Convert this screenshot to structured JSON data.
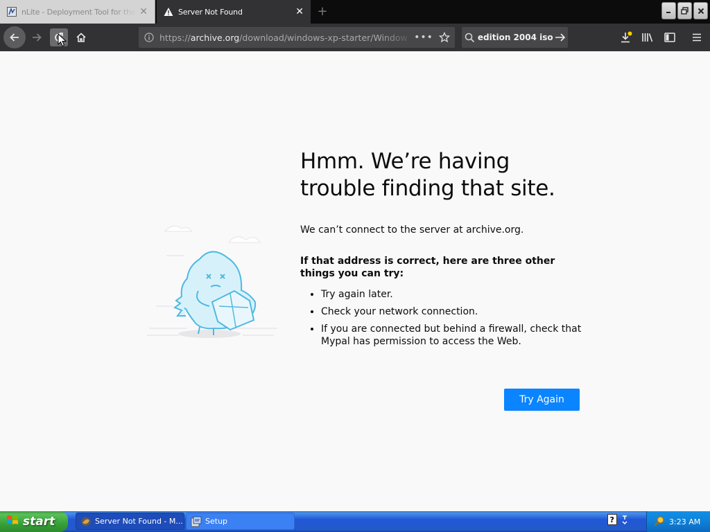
{
  "tabs": [
    {
      "title": "nLite - Deployment Tool for the b",
      "active": false,
      "favicon": "nlite-icon"
    },
    {
      "title": "Server Not Found",
      "active": true,
      "favicon": "warning-icon"
    }
  ],
  "toolbar": {
    "url_scheme": "https://",
    "url_domain": "archive.org",
    "url_path": "/download/windows-xp-starter/Window",
    "search_text": "edition 2004 iso"
  },
  "error_page": {
    "title": "Hmm. We’re having trouble finding that site.",
    "message": "We can’t connect to the server at archive.org.",
    "subheading": "If that address is correct, here are three other things you can try:",
    "tips": [
      "Try again later.",
      "Check your network connection.",
      "If you are connected but behind a firewall, check that Mypal has permission to access the Web."
    ],
    "button_label": "Try Again"
  },
  "taskbar": {
    "start_label": "start",
    "tasks": [
      {
        "label": "Server Not Found - M...",
        "active": true
      },
      {
        "label": "Setup",
        "active": false
      }
    ],
    "clock": "3:23 AM"
  },
  "colors": {
    "tab_strip": "#0c0c0d",
    "toolbar": "#323234",
    "page_background": "#f9f9fa",
    "primary_button": "#0a84ff",
    "taskbar": "#225ac8",
    "start_button": "#37a137"
  }
}
